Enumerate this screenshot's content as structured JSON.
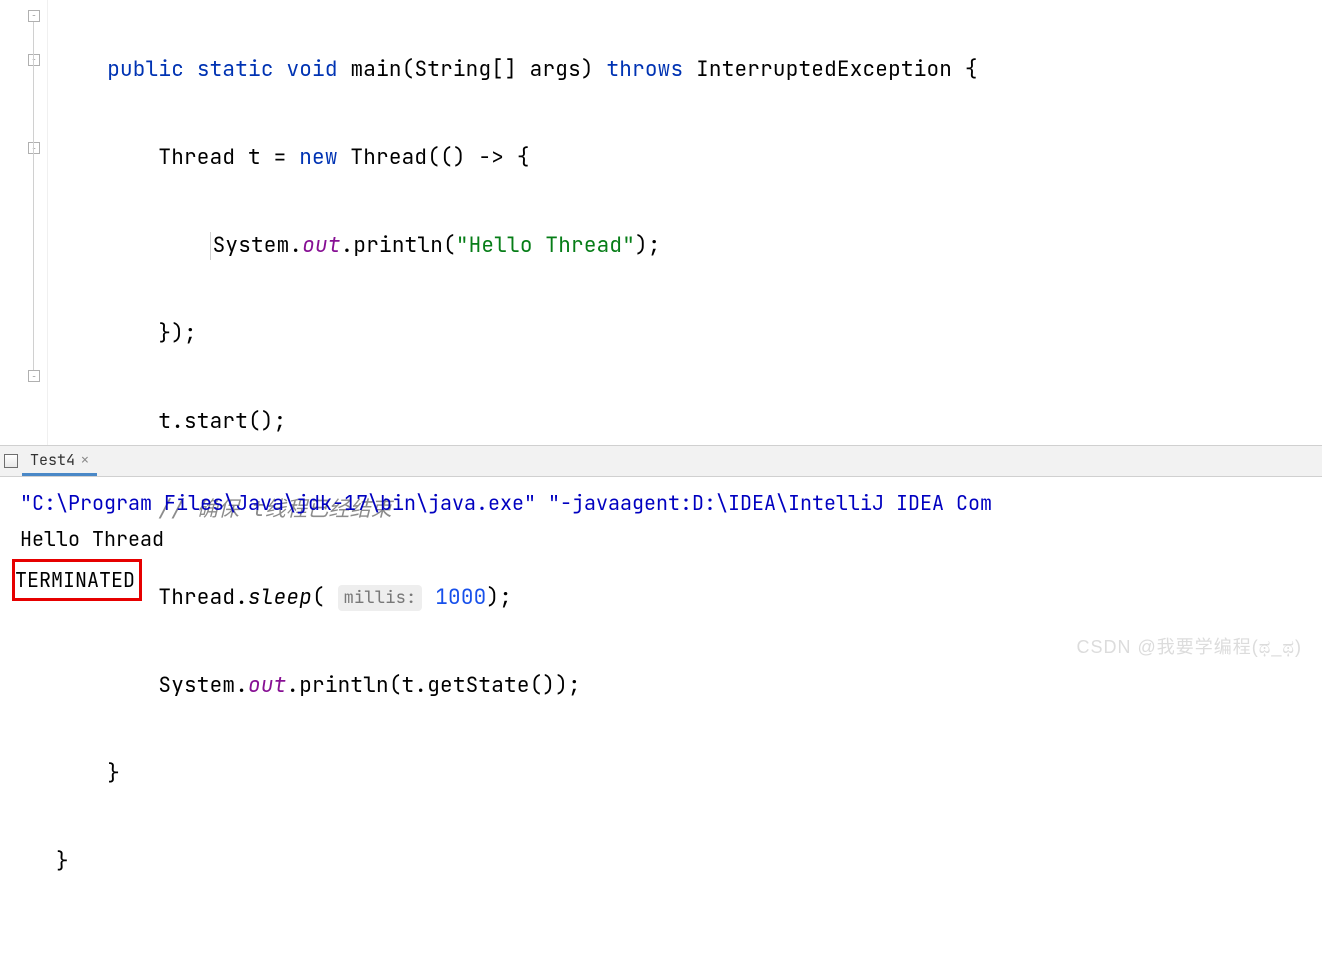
{
  "code": {
    "line1": {
      "indent": "    ",
      "kw_public": "public",
      "kw_static": "static",
      "kw_void": "void",
      "method": "main",
      "params": "(String[] args)",
      "kw_throws": "throws",
      "exception": "InterruptedException",
      "brace": " {"
    },
    "line2": {
      "indent": "        ",
      "text1": "Thread t = ",
      "kw_new": "new",
      "text2": " Thread(() -> {"
    },
    "line3": {
      "indent": "            ",
      "text1": "System.",
      "field_out": "out",
      "text2": ".println(",
      "str": "\"Hello Thread\"",
      "text3": ");"
    },
    "line4": {
      "indent": "        ",
      "text": "});"
    },
    "line5": {
      "indent": "        ",
      "text": "t.start();"
    },
    "line6": {
      "indent": "        ",
      "comment": "// 确保 t线程已经结束"
    },
    "line7": {
      "indent": "        ",
      "text1": "Thread.",
      "method": "sleep",
      "paren_open": "( ",
      "hint": "millis:",
      "num": " 1000",
      "paren_close": ");"
    },
    "line8": {
      "indent": "        ",
      "text1": "System.",
      "field_out": "out",
      "text2": ".println(t.getState());"
    },
    "line9": {
      "indent": "    ",
      "brace": "}"
    },
    "line10": {
      "indent": "",
      "brace": "}"
    }
  },
  "console": {
    "tab_label": "Test4",
    "cmd": "\"C:\\Program Files\\Java\\jdk-17\\bin\\java.exe\" \"-javaagent:D:\\IDEA\\IntelliJ IDEA Com",
    "out1": "Hello Thread",
    "out2": "TERMINATED"
  },
  "watermark": "CSDN @我要学编程(ಥ_ಥ)"
}
